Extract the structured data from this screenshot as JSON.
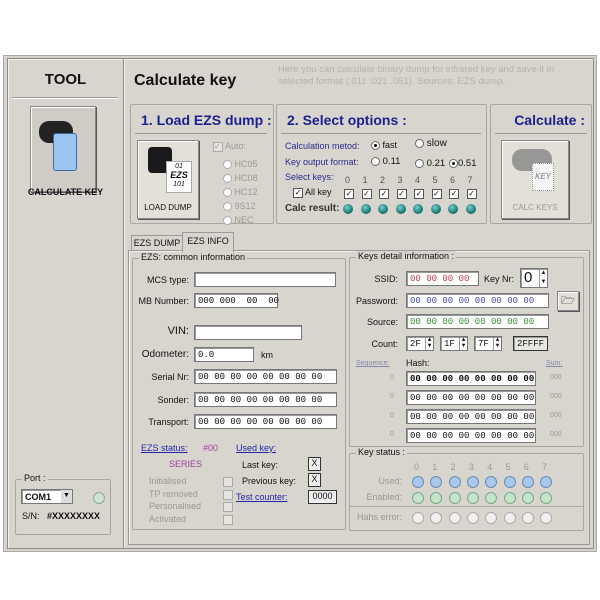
{
  "sidebar": {
    "title": "TOOL",
    "tool_label": "CALCULATE KEY",
    "port_label": "Port :",
    "port_value": "COM1",
    "sn_label": "S/N:",
    "sn_value": "#XXXXXXXX"
  },
  "header": {
    "title": "Calculate key",
    "description": "Here you can calculate binary dump for infrared key and save it in selected format (.011 .021 .051). Sources:  EZS dump."
  },
  "load": {
    "title": "1. Load EZS dump :",
    "button": "LOAD DUMP",
    "icon_text": [
      "01",
      "EZS",
      "101"
    ],
    "auto_label": "Auto:",
    "chips": [
      "HC05",
      "HC08",
      "HC12",
      "9S12",
      "NEC"
    ]
  },
  "options": {
    "title": "2. Select options :",
    "method_label": "Calculation metod:",
    "method_options": [
      "fast",
      "slow"
    ],
    "method_selected": "fast",
    "format_label": "Key output format:",
    "format_options": [
      "0.11",
      "0.21",
      "0.51"
    ],
    "format_selected": "0.51",
    "select_keys_label": "Select keys:",
    "all_key_label": "All key",
    "key_numbers": [
      "0",
      "1",
      "2",
      "3",
      "4",
      "5",
      "6",
      "7"
    ],
    "calc_result_label": "Calc result:"
  },
  "calculate": {
    "title": "Calculate :",
    "button": "CALC KEYS",
    "icon_text": "KEY"
  },
  "tabs": [
    {
      "label": "EZS DUMP"
    },
    {
      "label": "EZS INFO",
      "active": true
    }
  ],
  "ezs": {
    "group_label": "EZS: common information",
    "mcs_label": "MCS type:",
    "mcs_value": "",
    "mb_label": "MB Number:",
    "mb_value": "000 000  00  00",
    "vin_label": "VIN:",
    "vin_value": "",
    "odo_label": "Odometer:",
    "odo_value": "0.0",
    "odo_unit": "km",
    "serial_label": "Serial Nr:",
    "serial_value": "00 00 00 00 00 00 00 00",
    "sonder_label": "Sonder:",
    "sonder_value": "00 00 00 00 00 00 00 00",
    "transport_label": "Transport:",
    "transport_value": "00 00 00 00 00 00 00 00",
    "status_label": "EZS status:",
    "status_value": "#00",
    "series": "SERIES",
    "flags": [
      "Initialised",
      "TP removed",
      "Personalised",
      "Activated"
    ],
    "used_key_label": "Used key:",
    "last_key_label": "Last key:",
    "last_key_value": "X",
    "prev_key_label": "Previous key:",
    "prev_key_value": "X",
    "test_counter_label": "Test counter:",
    "test_counter_value": "0000"
  },
  "keys": {
    "group_label": "Keys detail information :",
    "ssid_label": "SSID:",
    "ssid_value": "00 00 00 00",
    "keynr_label": "Key Nr:",
    "keynr_value": "0",
    "password_label": "Password:",
    "password_value": "00 00 00 00 00 00 00 00",
    "source_label": "Source:",
    "source_value": "00 00 00 00 00 00 00 00",
    "count_label": "Count:",
    "counts": [
      "2F",
      "1F",
      "7F"
    ],
    "count_total": "2FFFF",
    "sequence_label": "Sequence:",
    "hash_label": "Hash:",
    "sum_label": "Sum:",
    "hash_rows": [
      {
        "seq": "0",
        "hash": "00 00 00 00 00 00 00 00",
        "sum": "000"
      },
      {
        "seq": "0",
        "hash": "00 00 00 00 00 00 00 00",
        "sum": "000"
      },
      {
        "seq": "0",
        "hash": "00 00 00 00 00 00 00 00",
        "sum": "000"
      },
      {
        "seq": "0",
        "hash": "00 00 00 00 00 00 00 00",
        "sum": "000"
      }
    ]
  },
  "key_status": {
    "group_label": "Key status :",
    "numbers": [
      "0",
      "1",
      "2",
      "3",
      "4",
      "5",
      "6",
      "7"
    ],
    "used_label": "Used:",
    "enabled_label": "Enabled:",
    "error_label": "Hahs error:"
  },
  "colors": {
    "header_blue": "#1b1f8f",
    "calc_dot": "#1d7d78",
    "used_dot": "#a8c8ec",
    "enabled_dot": "#c4e4cc",
    "error_dot": "#f2eeee",
    "ssid_text": "#b04050",
    "password_text": "#4a4aa0",
    "source_text": "#3a8a3a",
    "status_value": "#a040a0"
  }
}
